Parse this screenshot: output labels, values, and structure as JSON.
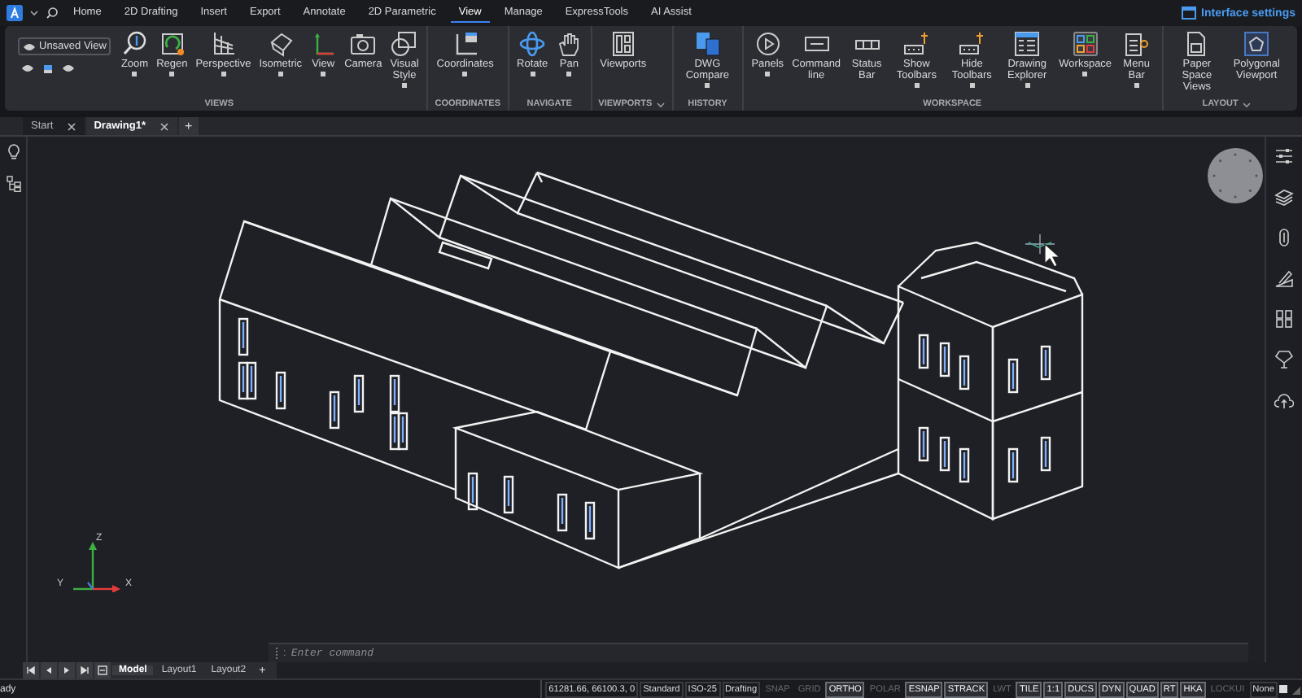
{
  "menubar": {
    "tabs": [
      {
        "label": "Home",
        "selected": false
      },
      {
        "label": "2D Drafting",
        "selected": false
      },
      {
        "label": "Insert",
        "selected": false
      },
      {
        "label": "Export",
        "selected": false
      },
      {
        "label": "Annotate",
        "selected": false
      },
      {
        "label": "2D Parametric",
        "selected": false
      },
      {
        "label": "View",
        "selected": true
      },
      {
        "label": "Manage",
        "selected": false
      },
      {
        "label": "ExpressTools",
        "selected": false
      },
      {
        "label": "AI Assist",
        "selected": false
      }
    ],
    "link": "Interface settings"
  },
  "ribbon": {
    "view_selector": {
      "value": "Unsaved View"
    },
    "panels": [
      {
        "title": "VIEWS",
        "expandable": false,
        "tools": [
          {
            "label": "Zoom",
            "dropdown": true
          },
          {
            "label": "Regen",
            "dropdown": true
          },
          {
            "label": "Perspective",
            "dropdown": true
          },
          {
            "label": "Isometric",
            "dropdown": true
          },
          {
            "label": "View",
            "dropdown": true
          },
          {
            "label": "Camera",
            "dropdown": false
          },
          {
            "label": "Visual Style",
            "dropdown": true
          }
        ]
      },
      {
        "title": "COORDINATES",
        "expandable": false,
        "tools": [
          {
            "label": "Coordinates",
            "dropdown": true
          }
        ]
      },
      {
        "title": "NAVIGATE",
        "expandable": false,
        "tools": [
          {
            "label": "Rotate",
            "dropdown": true
          },
          {
            "label": "Pan",
            "dropdown": true
          }
        ]
      },
      {
        "title": "VIEWPORTS",
        "expandable": true,
        "tools": [
          {
            "label": "Viewports",
            "dropdown": false
          }
        ]
      },
      {
        "title": "HISTORY",
        "expandable": false,
        "tools": [
          {
            "label": "DWG Compare",
            "dropdown": true
          }
        ]
      },
      {
        "title": "WORKSPACE",
        "expandable": false,
        "tools": [
          {
            "label": "Panels",
            "dropdown": true
          },
          {
            "label": "Command line",
            "dropdown": false
          },
          {
            "label": "Status Bar",
            "dropdown": false
          },
          {
            "label": "Show Toolbars",
            "dropdown": true
          },
          {
            "label": "Hide Toolbars",
            "dropdown": true
          },
          {
            "label": "Drawing Explorer",
            "dropdown": true
          },
          {
            "label": "Workspace",
            "dropdown": true
          },
          {
            "label": "Menu Bar",
            "dropdown": true
          }
        ]
      },
      {
        "title": "LAYOUT",
        "expandable": true,
        "tools": [
          {
            "label": "Paper Space Views",
            "dropdown": false
          },
          {
            "label": "Polygonal Viewport",
            "dropdown": false
          }
        ]
      }
    ]
  },
  "document_tabs": {
    "tabs": [
      {
        "label": "Start",
        "selected": false
      },
      {
        "label": "Drawing1*",
        "selected": true
      }
    ],
    "new_tab": "+"
  },
  "viewport": {
    "ucs_axes": {
      "z": "Z",
      "y": "Y",
      "x": "X"
    },
    "command_line": {
      "prompt": ":",
      "placeholder": "Enter command"
    }
  },
  "layout_tabs": {
    "tabs": [
      {
        "label": "Model",
        "selected": true
      },
      {
        "label": "Layout1",
        "selected": false
      },
      {
        "label": "Layout2",
        "selected": false
      }
    ],
    "new_tab": "+"
  },
  "status_bar": {
    "message": "ady",
    "items": [
      {
        "kind": "field",
        "label": "61281.66, 66100.3, 0"
      },
      {
        "kind": "field",
        "label": "Standard"
      },
      {
        "kind": "field",
        "label": "ISO-25"
      },
      {
        "kind": "field",
        "label": "Drafting"
      },
      {
        "kind": "toggle",
        "label": "SNAP",
        "on": false
      },
      {
        "kind": "toggle",
        "label": "GRID",
        "on": false
      },
      {
        "kind": "toggle",
        "label": "ORTHO",
        "on": true
      },
      {
        "kind": "toggle",
        "label": "POLAR",
        "on": false
      },
      {
        "kind": "toggle",
        "label": "ESNAP",
        "on": true
      },
      {
        "kind": "toggle",
        "label": "STRACK",
        "on": true
      },
      {
        "kind": "toggle",
        "label": "LWT",
        "on": false
      },
      {
        "kind": "toggle",
        "label": "TILE",
        "on": true
      },
      {
        "kind": "toggle",
        "label": "1:1",
        "on": true
      },
      {
        "kind": "toggle",
        "label": "DUCS",
        "on": true
      },
      {
        "kind": "toggle",
        "label": "DYN",
        "on": true
      },
      {
        "kind": "toggle",
        "label": "QUAD",
        "on": true
      },
      {
        "kind": "toggle",
        "label": "RT",
        "on": true
      },
      {
        "kind": "toggle",
        "label": "HKA",
        "on": true
      },
      {
        "kind": "toggle",
        "label": "LOCKUI",
        "on": false
      },
      {
        "kind": "field",
        "label": "None"
      }
    ]
  }
}
